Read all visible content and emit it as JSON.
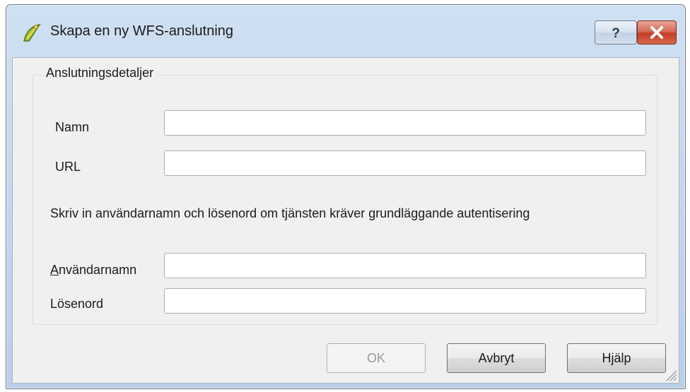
{
  "window": {
    "title": "Skapa en ny WFS-anslutning",
    "help_symbol": "?",
    "close_symbol": "×"
  },
  "group": {
    "title": "Anslutningsdetaljer"
  },
  "fields": {
    "name_label": "Namn",
    "name_value": "",
    "url_label": "URL",
    "url_value": "",
    "auth_info": "Skriv in användarnamn och lösenord om tjänsten kräver grundläggande autentisering",
    "username_label_mnemonic": "A",
    "username_label_rest": "nvändarnamn",
    "username_value": "",
    "password_label": "Lösenord",
    "password_value": ""
  },
  "buttons": {
    "ok": "OK",
    "cancel": "Avbryt",
    "help": "Hjälp"
  },
  "icons": {
    "app": "qgis-logo-icon",
    "help": "question-icon",
    "close": "close-icon",
    "resize": "size-grip-icon"
  },
  "colors": {
    "title_bar": "#c5d8ee",
    "close_button": "#c94a33",
    "dialog_bg": "#f0f0f0"
  }
}
